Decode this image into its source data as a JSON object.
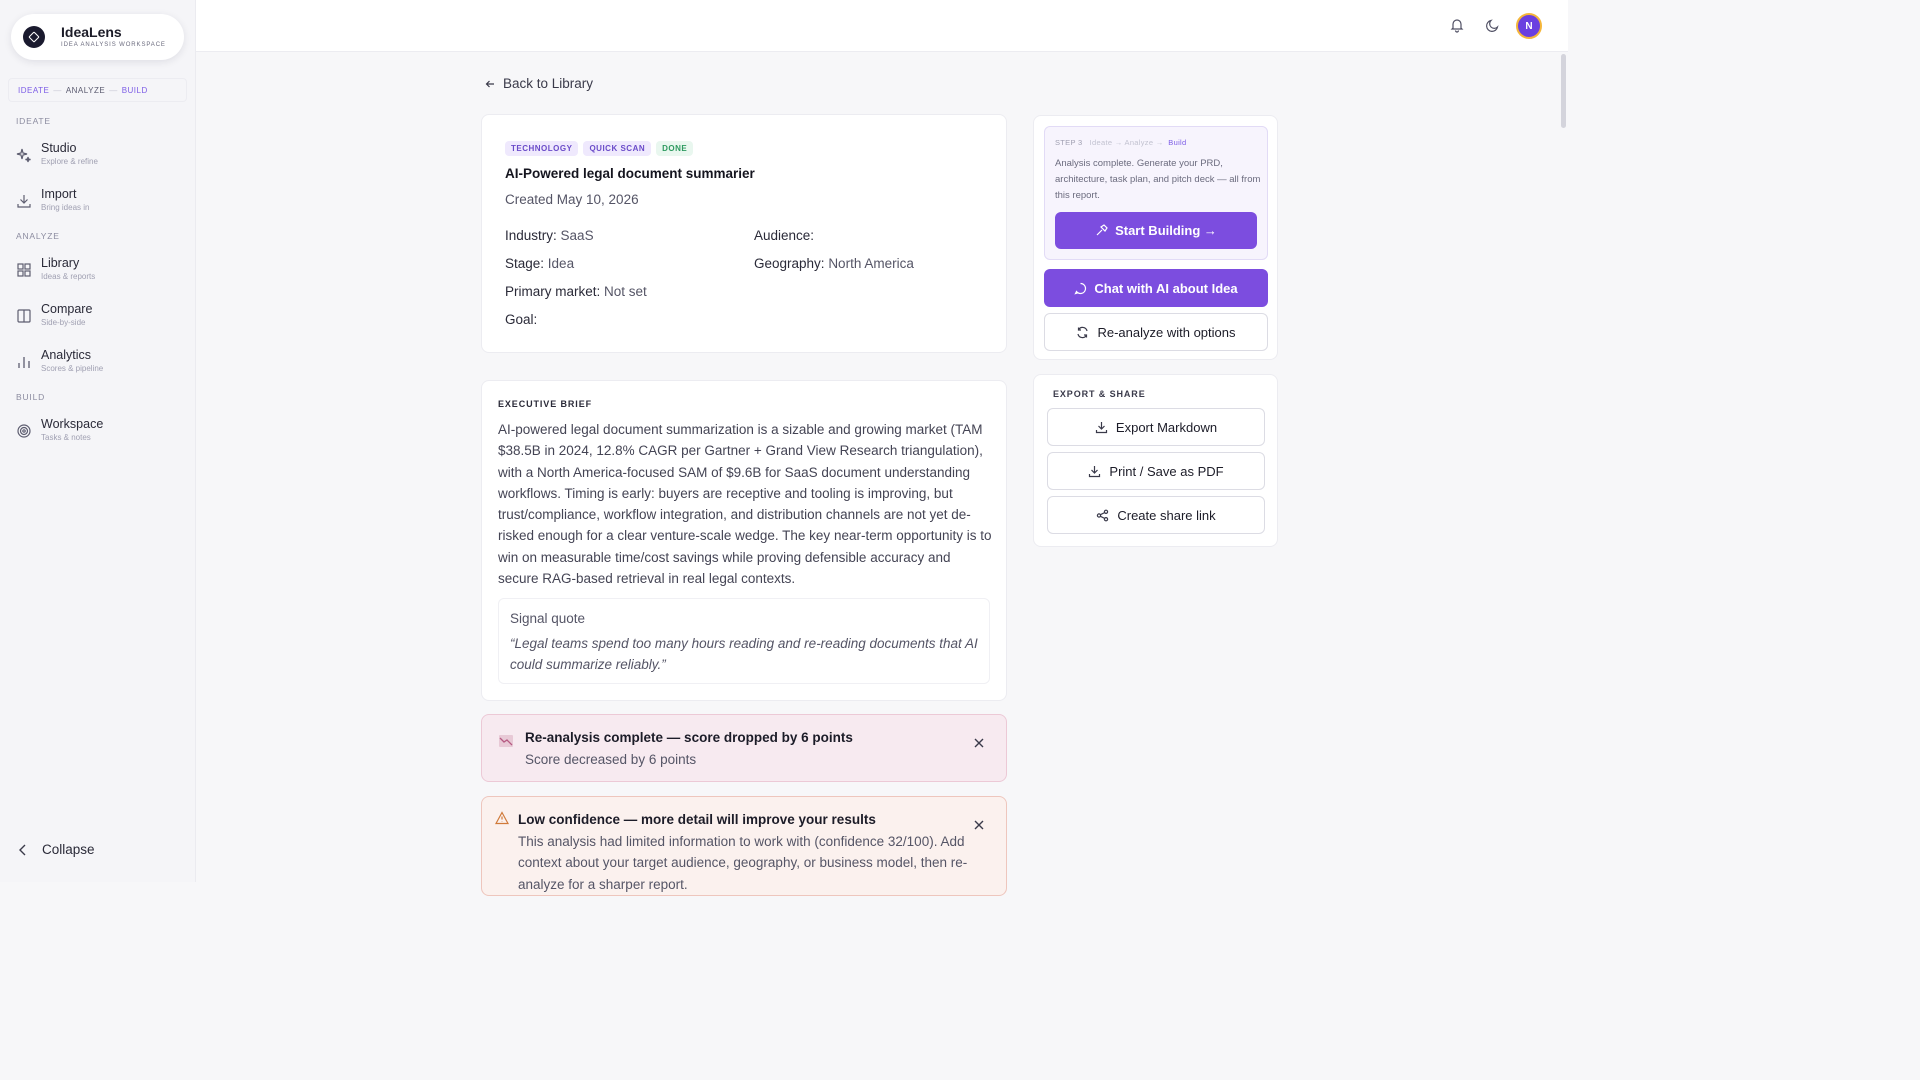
{
  "brand": {
    "name": "IdeaLens",
    "subtitle": "IDEA ANALYSIS WORKSPACE"
  },
  "flow": {
    "step1": "IDEATE",
    "step2": "ANALYZE",
    "step3": "BUILD",
    "sep": "—"
  },
  "sidebar": {
    "sections": {
      "ideate": "IDEATE",
      "analyze": "ANALYZE",
      "build": "BUILD"
    },
    "items": [
      {
        "label": "Studio",
        "sub": "Explore & refine",
        "icon": "sparkle-icon"
      },
      {
        "label": "Import",
        "sub": "Bring ideas in",
        "icon": "download-icon"
      },
      {
        "label": "Library",
        "sub": "Ideas & reports",
        "icon": "grid-icon"
      },
      {
        "label": "Compare",
        "sub": "Side-by-side",
        "icon": "columns-icon"
      },
      {
        "label": "Analytics",
        "sub": "Scores & pipeline",
        "icon": "bar-chart-icon"
      },
      {
        "label": "Workspace",
        "sub": "Tasks & notes",
        "icon": "target-icon"
      }
    ],
    "collapse": "Collapse"
  },
  "header": {
    "avatar_initial": "N",
    "icons": [
      "bell-icon",
      "moon-icon"
    ]
  },
  "back": "Back to Library",
  "idea": {
    "badges": [
      "TECHNOLOGY",
      "QUICK SCAN",
      "DONE"
    ],
    "title": "AI-Powered legal document summarier",
    "created": "Created May 10, 2026",
    "meta": {
      "industry_label": "Industry:",
      "industry": "SaaS",
      "audience_label": "Audience:",
      "audience": "",
      "stage_label": "Stage:",
      "stage": "Idea",
      "geography_label": "Geography:",
      "geography": "North America",
      "primary_market_label": "Primary market:",
      "primary_market": "Not set",
      "goal_label": "Goal:",
      "goal": ""
    }
  },
  "executive": {
    "label": "EXECUTIVE BRIEF",
    "body": "AI-powered legal document summarization is a sizable and growing market (TAM $38.5B in 2024, 12.8% CAGR per Gartner + Grand View Research triangulation), with a North America-focused SAM of $9.6B for SaaS document understanding workflows. Timing is early: buyers are receptive and tooling is improving, but trust/compliance, workflow integration, and distribution channels are not yet de-risked enough for a clear venture-scale wedge. The key near-term opportunity is to win on measurable time/cost savings while proving defensible accuracy and secure RAG-based retrieval in real legal contexts.",
    "quote_label": "Signal quote",
    "quote": "“Legal teams spend too many hours reading and re-reading documents that AI could summarize reliably.”"
  },
  "alerts": {
    "reanalysis_title": "Re-analysis complete — score dropped by 6 points",
    "reanalysis_body": "Score decreased by 6 points",
    "confidence_title": "Low confidence — more detail will improve your results",
    "confidence_body": "This analysis had limited information to work with (confidence 32/100). Add context about your target audience, geography, or business model, then re-analyze for a sharper report."
  },
  "build_panel": {
    "step": "STEP 3",
    "crumb1": "Ideate",
    "crumb2": "Analyze",
    "crumb3": "Build",
    "arrow": "→",
    "desc": "Analysis complete. Generate your PRD, architecture, task plan, and pitch deck — all from this report.",
    "start": "Start Building →",
    "chat": "Chat with AI about Idea",
    "reanalyze": "Re-analyze with options"
  },
  "export": {
    "label": "EXPORT & SHARE",
    "markdown": "Export Markdown",
    "pdf": "Print / Save as PDF",
    "share": "Create share link"
  },
  "colors": {
    "accent": "#7c4ddf",
    "avatar": "#6a3fe0",
    "alert_red_bg": "#f7eaf0",
    "alert_orange_bg": "#fbf1ee"
  }
}
